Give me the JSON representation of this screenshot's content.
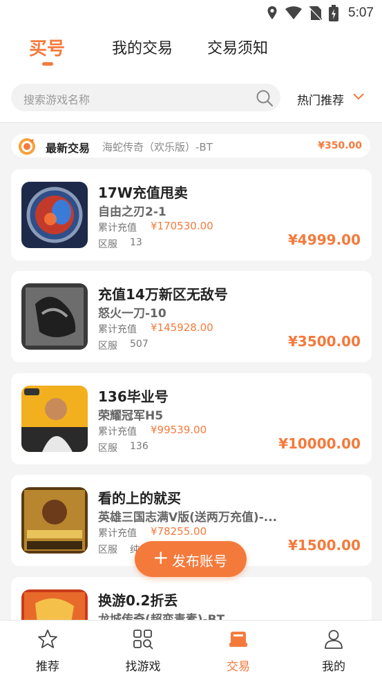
{
  "status_bar": {
    "time": "5:07"
  },
  "tabs": [
    {
      "label": "买号",
      "active": true
    },
    {
      "label": "我的交易",
      "active": false
    },
    {
      "label": "交易须知",
      "active": false
    }
  ],
  "search": {
    "placeholder": "搜索游戏名称"
  },
  "sort": {
    "label": "热门推荐"
  },
  "ticker": {
    "title": "最新交易",
    "game": "海蛇传奇（欢乐版）-BT",
    "price": "¥350.00"
  },
  "listings": [
    {
      "title": "17W充值甩卖",
      "game": "自由之刃2-1",
      "charge_label": "累计充值",
      "charge": "¥170530.00",
      "server_label": "区服",
      "server": "13",
      "price": "¥4999.00"
    },
    {
      "title": "充值14万新区无敌号",
      "game": "怒火一刀-10",
      "charge_label": "累计充值",
      "charge": "¥145928.00",
      "server_label": "区服",
      "server": "507",
      "price": "¥3500.00"
    },
    {
      "title": "136毕业号",
      "game": "荣耀冠军H5",
      "charge_label": "累计充值",
      "charge": "¥99539.00",
      "server_label": "区服",
      "server": "136",
      "price": "¥10000.00"
    },
    {
      "title": "看的上的就买",
      "game": "英雄三国志满V版(送两万充值)-...",
      "charge_label": "累计充值",
      "charge": "¥78255.00",
      "server_label": "区服",
      "server": "纯",
      "price": "¥1500.00"
    },
    {
      "title": "换游0.2折丢",
      "game": "龙城传奇(超变毒素)-BT",
      "charge_label": "",
      "charge": "",
      "server_label": "",
      "server": "",
      "price": ""
    }
  ],
  "publish_button": {
    "plus": "+",
    "label": "发布账号"
  },
  "bottom_nav": [
    {
      "label": "推荐",
      "icon": "star-icon",
      "active": false
    },
    {
      "label": "找游戏",
      "icon": "grid-search-icon",
      "active": false
    },
    {
      "label": "交易",
      "icon": "trade-icon",
      "active": true
    },
    {
      "label": "我的",
      "icon": "user-icon",
      "active": false
    }
  ],
  "colors": {
    "accent": "#f47a3c",
    "background": "#f4f4f4",
    "card": "#ffffff"
  }
}
